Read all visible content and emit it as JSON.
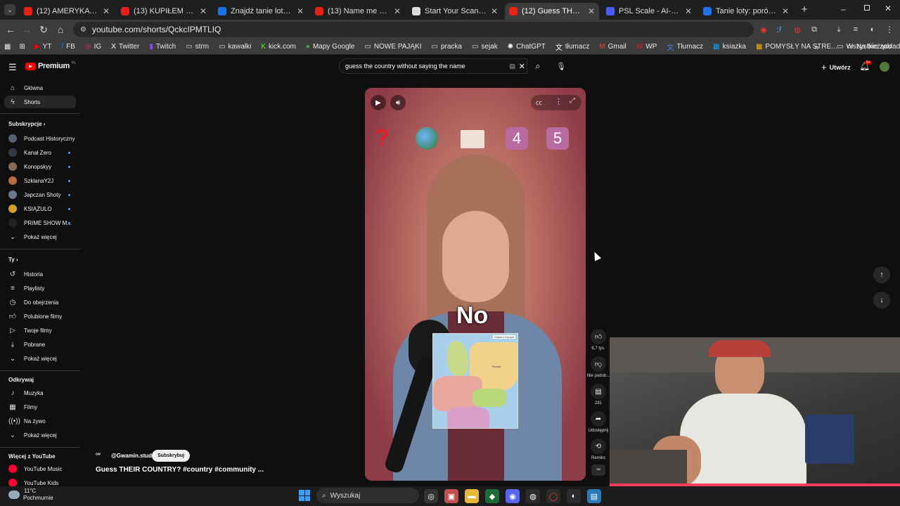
{
  "browser": {
    "tabs": [
      {
        "title": "(12) AMERYKA ŚCIĄGA PO",
        "favicon_color": "#e62117"
      },
      {
        "title": "(13) KUPIŁEM DOM! - You",
        "favicon_color": "#e62117"
      },
      {
        "title": "Znajdź tanie loty z: Krakó",
        "favicon_color": "#1a73e8"
      },
      {
        "title": "(13) Name me a country t",
        "favicon_color": "#e62117"
      },
      {
        "title": "Start Your Scan | FaceIQ L",
        "favicon_color": "#dddddd"
      },
      {
        "title": "(12) Guess THEIR COUNT",
        "favicon_color": "#e62117",
        "active": true
      },
      {
        "title": "PSL Scale - AI-Powered F",
        "favicon_color": "#4a5cff"
      },
      {
        "title": "Tanie loty: porównaj i zar",
        "favicon_color": "#1a73e8"
      }
    ],
    "new_tab": "+",
    "url": "youtube.com/shorts/QckcIPMTLIQ",
    "bookmarks": [
      {
        "label": "YT",
        "icon": "youtube-icon",
        "color": "#ff0000"
      },
      {
        "label": "FB",
        "icon": "facebook-icon",
        "color": "#1877f2"
      },
      {
        "label": "IG",
        "icon": "instagram-icon",
        "color": "#e1306c"
      },
      {
        "label": "Twitter",
        "icon": "x-icon",
        "color": "#ffffff"
      },
      {
        "label": "Twitch",
        "icon": "twitch-icon",
        "color": "#9146ff"
      },
      {
        "label": "strm",
        "icon": "folder-icon",
        "color": "#dddddd"
      },
      {
        "label": "kawałki",
        "icon": "folder-icon",
        "color": "#dddddd"
      },
      {
        "label": "kick.com",
        "icon": "kick-icon",
        "color": "#53fc18"
      },
      {
        "label": "Mapy Google",
        "icon": "maps-icon",
        "color": "#34a853"
      },
      {
        "label": "NOWE PAJĄKI",
        "icon": "folder-icon",
        "color": "#dddddd"
      },
      {
        "label": "pracka",
        "icon": "folder-icon",
        "color": "#dddddd"
      },
      {
        "label": "sejak",
        "icon": "folder-icon",
        "color": "#dddddd"
      },
      {
        "label": "ChatGPT",
        "icon": "chatgpt-icon",
        "color": "#ffffff"
      },
      {
        "label": "tłumacz",
        "icon": "translate-icon",
        "color": "#ffffff"
      },
      {
        "label": "Gmail",
        "icon": "gmail-icon",
        "color": "#ea4335"
      },
      {
        "label": "WP",
        "icon": "wp-icon",
        "color": "#e31e24"
      },
      {
        "label": "Tłumacz",
        "icon": "translate-icon",
        "color": "#4285f4"
      },
      {
        "label": "ksiazka",
        "icon": "windows-icon",
        "color": "#00a4ef"
      },
      {
        "label": "POMYSŁY NA STRE...",
        "icon": "sheet-icon",
        "color": "#f4b400"
      },
      {
        "label": "Na bieżąco",
        "icon": "folder-icon",
        "color": "#dddddd"
      }
    ],
    "bookmarks_overflow": "»",
    "all_bookmarks": "Wszystkie zakładki"
  },
  "youtube": {
    "logo": "Premium",
    "logo_region": "PL",
    "search_value": "guess the country without saying the name",
    "create_label": "Utwórz",
    "notifications_badge": "9+",
    "sidebar": {
      "main": [
        {
          "label": "Główna",
          "icon": "home-icon"
        },
        {
          "label": "Shorts",
          "icon": "shorts-icon",
          "active": true
        }
      ],
      "subs_header": "Subskrypcje",
      "subs": [
        {
          "label": "Podcast Historyczny",
          "color": "#556070"
        },
        {
          "label": "Kanał Zero",
          "color": "#333a44"
        },
        {
          "label": "Konopskyy",
          "color": "#8a6a50"
        },
        {
          "label": "SzklanaY2J",
          "color": "#b86a40"
        },
        {
          "label": "Japczan Shoty",
          "color": "#6a7a8a"
        },
        {
          "label": "KSIĄŻULO",
          "color": "#d4a020"
        },
        {
          "label": "PRIME SHOW M...",
          "color": "#222222"
        }
      ],
      "subs_more": "Pokaż więcej",
      "you_header": "Ty",
      "you": [
        {
          "label": "Historia",
          "icon": "history-icon"
        },
        {
          "label": "Playlisty",
          "icon": "playlist-icon"
        },
        {
          "label": "Do obejrzenia",
          "icon": "clock-icon"
        },
        {
          "label": "Polubione filmy",
          "icon": "like-icon"
        },
        {
          "label": "Twoje filmy",
          "icon": "video-icon"
        },
        {
          "label": "Pobrane",
          "icon": "download-icon"
        }
      ],
      "you_more": "Pokaż więcej",
      "explore_header": "Odkrywaj",
      "explore": [
        {
          "label": "Muzyka",
          "icon": "music-icon"
        },
        {
          "label": "Filmy",
          "icon": "film-icon"
        },
        {
          "label": "Na żywo",
          "icon": "live-icon"
        }
      ],
      "explore_more": "Pokaż więcej",
      "more_header": "Więcej z YouTube",
      "more": [
        {
          "label": "YouTube Music",
          "color": "#ff0033"
        },
        {
          "label": "YouTube Kids",
          "color": "#ff0033"
        }
      ]
    },
    "short": {
      "channel": "@Gwamin.studio",
      "subscribe": "Subskrybuj",
      "title": "Guess THEIR COUNTRY? #country #community ...",
      "caption": "No",
      "overlay_numbers": [
        "4",
        "5"
      ],
      "map_label": "Eastern Europe",
      "map_country": "Russia",
      "likes": "6,7 tys.",
      "dislike": "Nie podob...",
      "comments": "281",
      "share": "Udostępnij",
      "remix": "Remiks"
    }
  },
  "taskbar": {
    "weather_temp": "11°C",
    "weather_desc": "Pochmurnie",
    "search_placeholder": "Wyszukaj"
  }
}
